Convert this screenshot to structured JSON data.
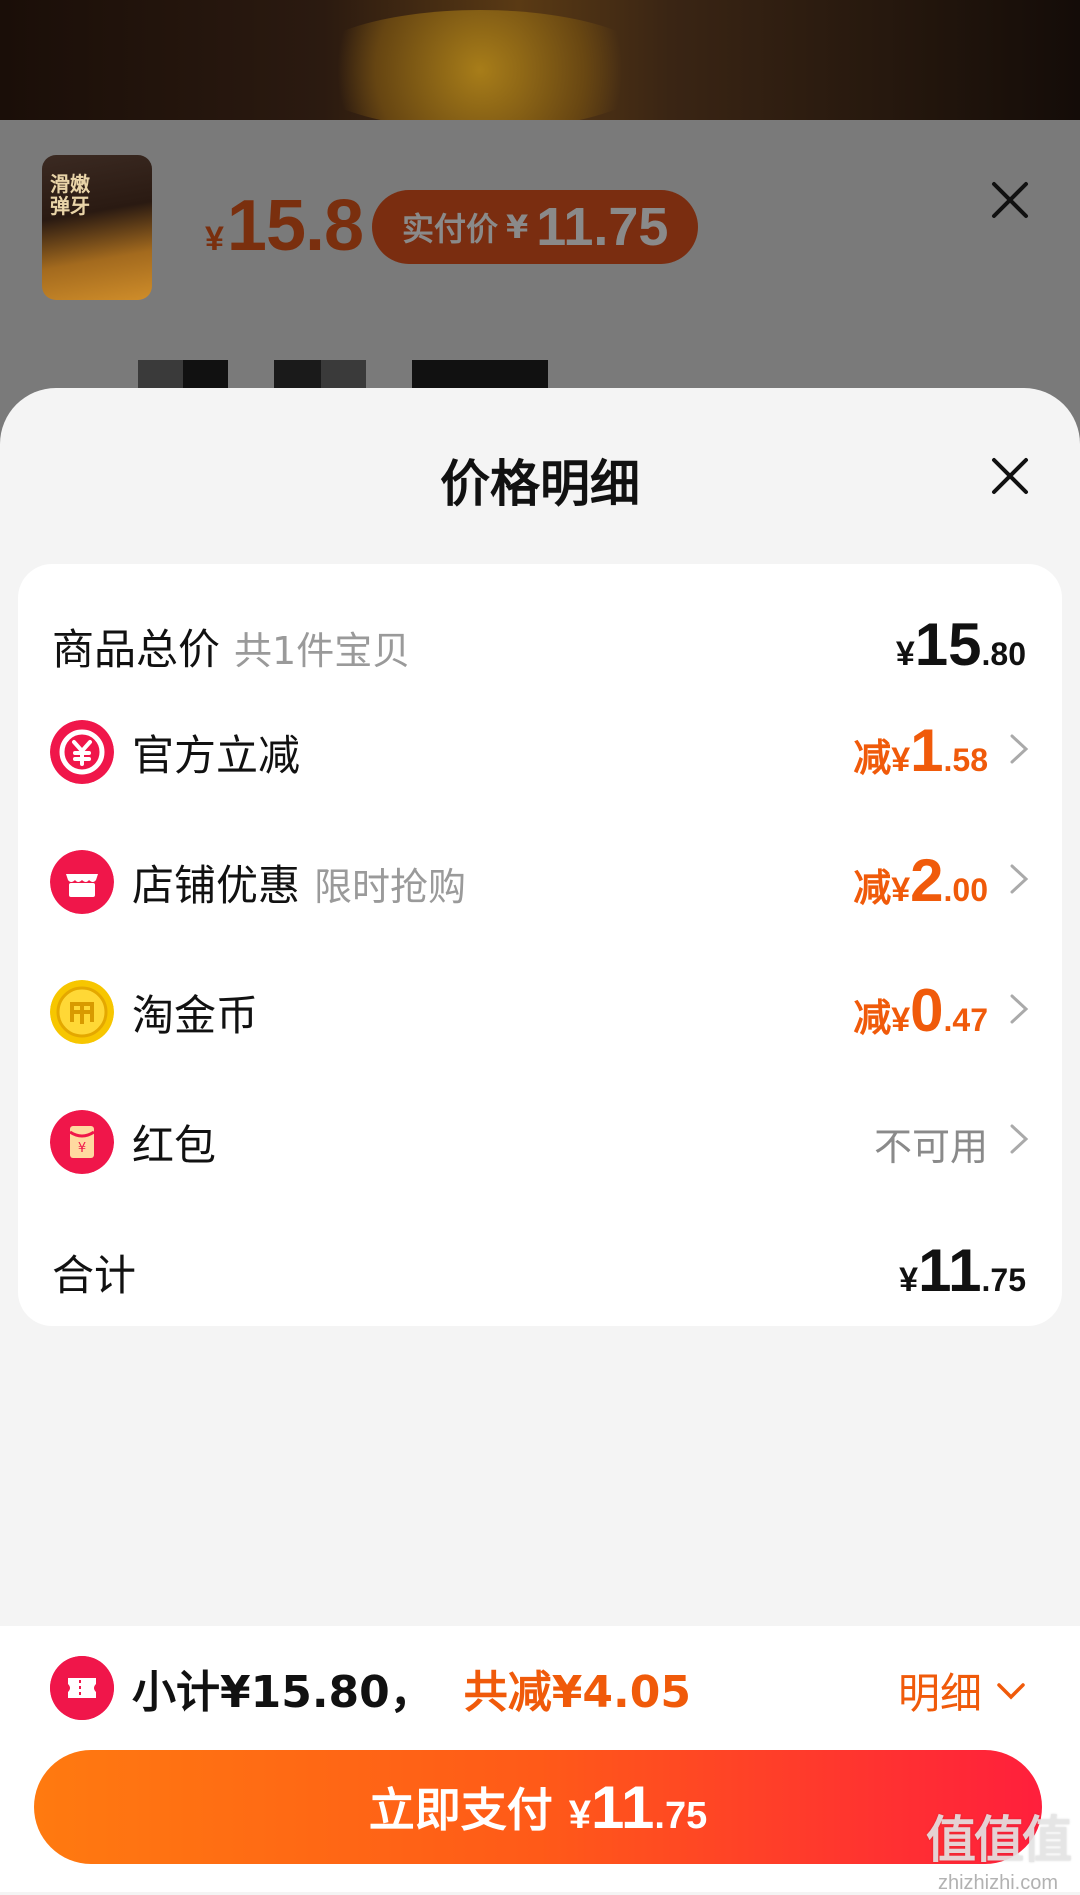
{
  "background": {
    "product_thumb_text": "滑嫩弹牙",
    "price_symbol": "¥",
    "price": "15.8",
    "actual_pay_label": "实付价",
    "actual_pay_symbol": "¥",
    "actual_pay_value": "11.75"
  },
  "sheet": {
    "title": "价格明细",
    "rows": {
      "total": {
        "label": "商品总价",
        "sub": "共1件宝贝",
        "sym": "¥",
        "int": "15",
        "dec": ".80"
      },
      "official": {
        "label": "官方立减",
        "prefix": "减",
        "sym": "¥",
        "int": "1",
        "dec": ".58",
        "icon": "official-discount-icon",
        "icon_color": "#f0164a"
      },
      "shop": {
        "label": "店铺优惠",
        "sub": "限时抢购",
        "prefix": "减",
        "sym": "¥",
        "int": "2",
        "dec": ".00",
        "icon": "shop-icon",
        "icon_color": "#f0164a"
      },
      "coin": {
        "label": "淘金币",
        "prefix": "减",
        "sym": "¥",
        "int": "0",
        "dec": ".47",
        "icon": "gold-coin-icon",
        "icon_color": "#f7c600"
      },
      "redpacket": {
        "label": "红包",
        "status": "不可用",
        "icon": "red-packet-icon",
        "icon_color": "#f0164a"
      },
      "sum": {
        "label": "合计",
        "sym": "¥",
        "int": "11",
        "dec": ".75"
      }
    }
  },
  "bottom": {
    "subtotal_text": "小计¥15.80，",
    "discount_text": "共减¥4.05",
    "detail_label": "明细",
    "pay_label": "立即支付",
    "pay_sym": "¥",
    "pay_int": "11",
    "pay_dec": ".75",
    "accent": "#f05a0a"
  },
  "watermark": {
    "logo": "值值值",
    "domain": "zhizhizhi.com"
  }
}
